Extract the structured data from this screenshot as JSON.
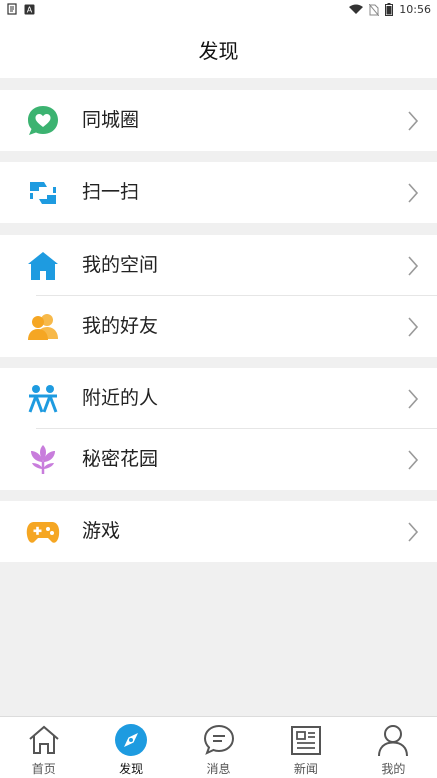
{
  "status_bar": {
    "time": "10:56",
    "left_icons": [
      "notification-icon",
      "app-icon"
    ],
    "right_icons": [
      "wifi-icon",
      "no-sim-icon",
      "battery-icon"
    ]
  },
  "header": {
    "title": "发现"
  },
  "groups": [
    {
      "items": [
        {
          "label": "同城圈",
          "icon": "heart-chat-icon",
          "color": "#3cb371"
        }
      ]
    },
    {
      "items": [
        {
          "label": "扫一扫",
          "icon": "scan-icon",
          "color": "#1e9be0"
        }
      ]
    },
    {
      "items": [
        {
          "label": "我的空间",
          "icon": "home-icon",
          "color": "#1e9be0"
        },
        {
          "label": "我的好友",
          "icon": "friends-icon",
          "color": "#f5a623"
        }
      ]
    },
    {
      "items": [
        {
          "label": "附近的人",
          "icon": "nearby-people-icon",
          "color": "#1e9be0"
        },
        {
          "label": "秘密花园",
          "icon": "flower-icon",
          "color": "#c87ddc"
        }
      ]
    },
    {
      "items": [
        {
          "label": "游戏",
          "icon": "gamepad-icon",
          "color": "#f5a623"
        }
      ]
    }
  ],
  "tabbar": {
    "active": "发现",
    "accent": "#1e9be0",
    "tabs": [
      {
        "label": "首页",
        "icon": "home-outline-icon"
      },
      {
        "label": "发现",
        "icon": "compass-icon"
      },
      {
        "label": "消息",
        "icon": "message-icon"
      },
      {
        "label": "新闻",
        "icon": "newspaper-icon"
      },
      {
        "label": "我的",
        "icon": "profile-icon"
      }
    ]
  }
}
